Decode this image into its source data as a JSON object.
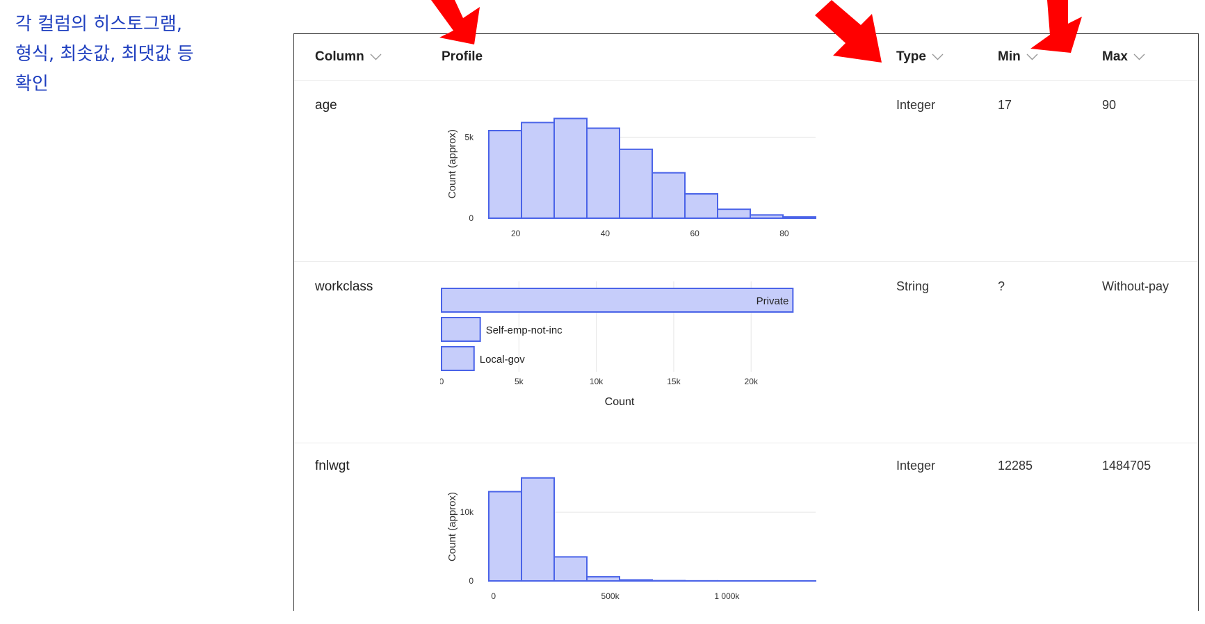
{
  "annotation": "각 컬럼의 히스토그램,\n형식, 최솟값, 최댓값 등\n확인",
  "headers": {
    "column": "Column",
    "profile": "Profile",
    "type": "Type",
    "min": "Min",
    "max": "Max"
  },
  "rows": [
    {
      "column": "age",
      "type": "Integer",
      "min": "17",
      "max": "90"
    },
    {
      "column": "workclass",
      "type": "String",
      "min": "?",
      "max": "Without-pay"
    },
    {
      "column": "fnlwgt",
      "type": "Integer",
      "min": "12285",
      "max": "1484705"
    }
  ],
  "colors": {
    "bar_fill": "#c6cdfa",
    "bar_stroke": "#4a63e8",
    "annotation": "#1f3fbf",
    "arrow": "#ff0000"
  },
  "icons": {
    "header_sort": "chevron-down-icon",
    "callout": "red-arrow-icon"
  },
  "chart_data": [
    {
      "type": "bar",
      "title": "age",
      "ylabel": "Count (approx)",
      "bin_edges": [
        14,
        21.3,
        28.6,
        35.9,
        43.2,
        50.5,
        57.8,
        65.1,
        72.4,
        79.7,
        87
      ],
      "values": [
        5400,
        5900,
        6150,
        5550,
        4250,
        2800,
        1500,
        550,
        200,
        80
      ],
      "xlim": [
        14,
        87
      ],
      "ylim": [
        0,
        7200
      ],
      "xticks": [
        "20",
        "40",
        "60",
        "80"
      ],
      "yticks": [
        "0",
        "5k"
      ],
      "xtick_values": [
        20,
        40,
        60,
        80
      ],
      "ytick_values": [
        0,
        5000
      ]
    },
    {
      "type": "bar",
      "orientation": "horizontal",
      "categories": [
        "Private",
        "Self-emp-not-inc",
        "Local-gov"
      ],
      "values": [
        22700,
        2500,
        2100
      ],
      "xlabel": "Count",
      "xlim": [
        0,
        23000
      ],
      "xticks": [
        "0",
        "5k",
        "10k",
        "15k",
        "20k"
      ],
      "xtick_values": [
        0,
        5000,
        10000,
        15000,
        20000
      ]
    },
    {
      "type": "bar",
      "title": "fnlwgt",
      "ylabel": "Count (approx)",
      "bin_edges": [
        -20000,
        120000,
        260000,
        400000,
        540000,
        680000,
        820000,
        960000,
        1100000,
        1240000,
        1380000
      ],
      "values": [
        13000,
        15000,
        3500,
        600,
        150,
        40,
        15,
        5,
        2,
        2
      ],
      "xlim": [
        -20000,
        1380000
      ],
      "ylim": [
        0,
        17000
      ],
      "xticks": [
        "0",
        "500k",
        "1 000k"
      ],
      "yticks": [
        "0",
        "10k"
      ],
      "xtick_values": [
        0,
        500000,
        1000000
      ],
      "ytick_values": [
        0,
        10000
      ]
    }
  ]
}
